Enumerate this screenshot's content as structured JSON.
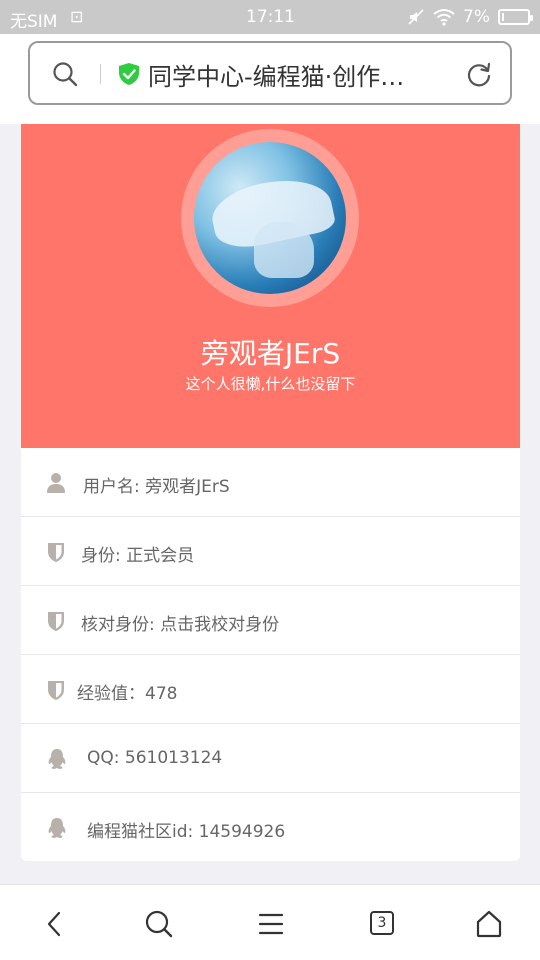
{
  "status_bar": {
    "carrier": "无SIM",
    "time": "17:11",
    "battery": "7%",
    "battery_level": 0.07
  },
  "address_bar": {
    "page_title": "同学中心-编程猫·创作…"
  },
  "profile": {
    "nickname": "旁观者JErS",
    "motto": "这个人很懒,什么也没留下"
  },
  "info_items": [
    {
      "icon": "user-icon",
      "text": "用户名: 旁观者JErS"
    },
    {
      "icon": "shield-icon",
      "text": "身份: 正式会员"
    },
    {
      "icon": "shield-icon",
      "text": "核对身份: 点击我校对身份"
    },
    {
      "icon": "shield-icon",
      "text": "经验值：478"
    },
    {
      "icon": "qq-icon",
      "text": "QQ: 561013124"
    },
    {
      "icon": "qq-icon",
      "text": "编程猫社区id: 14594926"
    }
  ],
  "bottom_nav": {
    "tab_count": "3"
  },
  "colors": {
    "header_bg": "#ff7569",
    "avatar_ring": "#ff9e94",
    "secure_green": "#2ecc40",
    "icon_gray": "#b8b0aa"
  }
}
